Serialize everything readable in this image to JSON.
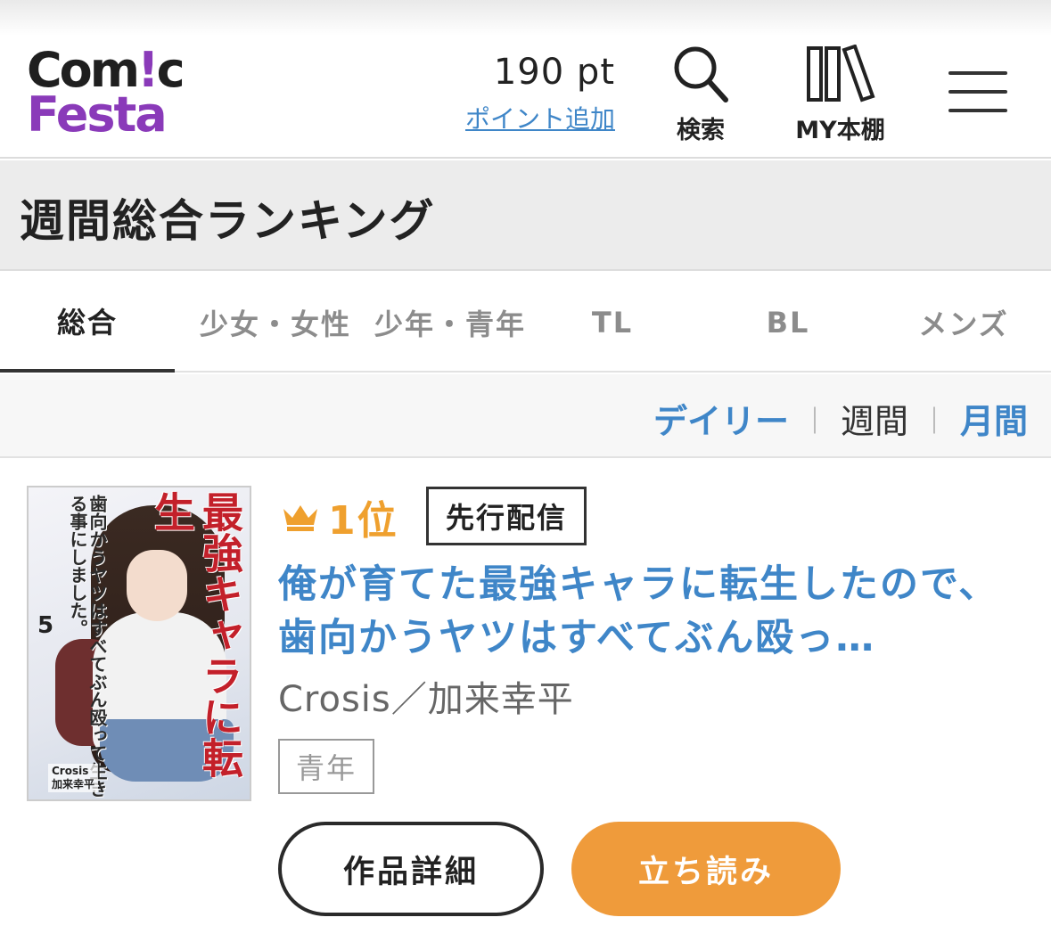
{
  "header": {
    "logo": {
      "line1_a": "Com",
      "line1_b": "!",
      "line1_c": "c",
      "line2": "Festa"
    },
    "points": {
      "value": "190 pt",
      "add_link": "ポイント追加"
    },
    "search_label": "検索",
    "bookshelf_label": "MY本棚",
    "icons": [
      "search-icon",
      "bookshelf-icon",
      "hamburger-menu-icon"
    ]
  },
  "page_title": "週間総合ランキング",
  "tabs": [
    {
      "label": "総合",
      "active": true
    },
    {
      "label": "少女・女性",
      "active": false
    },
    {
      "label": "少年・青年",
      "active": false
    },
    {
      "label": "TL",
      "active": false
    },
    {
      "label": "BL",
      "active": false
    },
    {
      "label": "メンズ",
      "active": false
    }
  ],
  "period": {
    "daily": "デイリー",
    "separator": "｜",
    "weekly": "週間",
    "monthly": "月間",
    "selected": "週間"
  },
  "ranking_item": {
    "rank": "1位",
    "badge": "先行配信",
    "title": "俺が育てた最強キャラに転生したので、歯向かうヤツはすべてぶん殴っ…",
    "author": "Crosis／加来幸平",
    "genre": "青年",
    "cover": {
      "title_text": "最強キャラに転生",
      "sub_text": "歯向かうヤツはすべてぶん殴って生きる事にしました。",
      "volume": "5",
      "credit_line1": "Crosis",
      "credit_line2": "加来幸平"
    },
    "detail_button": "作品詳細",
    "read_button": "立ち読み"
  },
  "colors": {
    "brand_purple": "#8a3ab9",
    "link_blue": "#3f86c8",
    "rank_gold": "#efa02e",
    "read_orange": "#ef9b3b"
  }
}
